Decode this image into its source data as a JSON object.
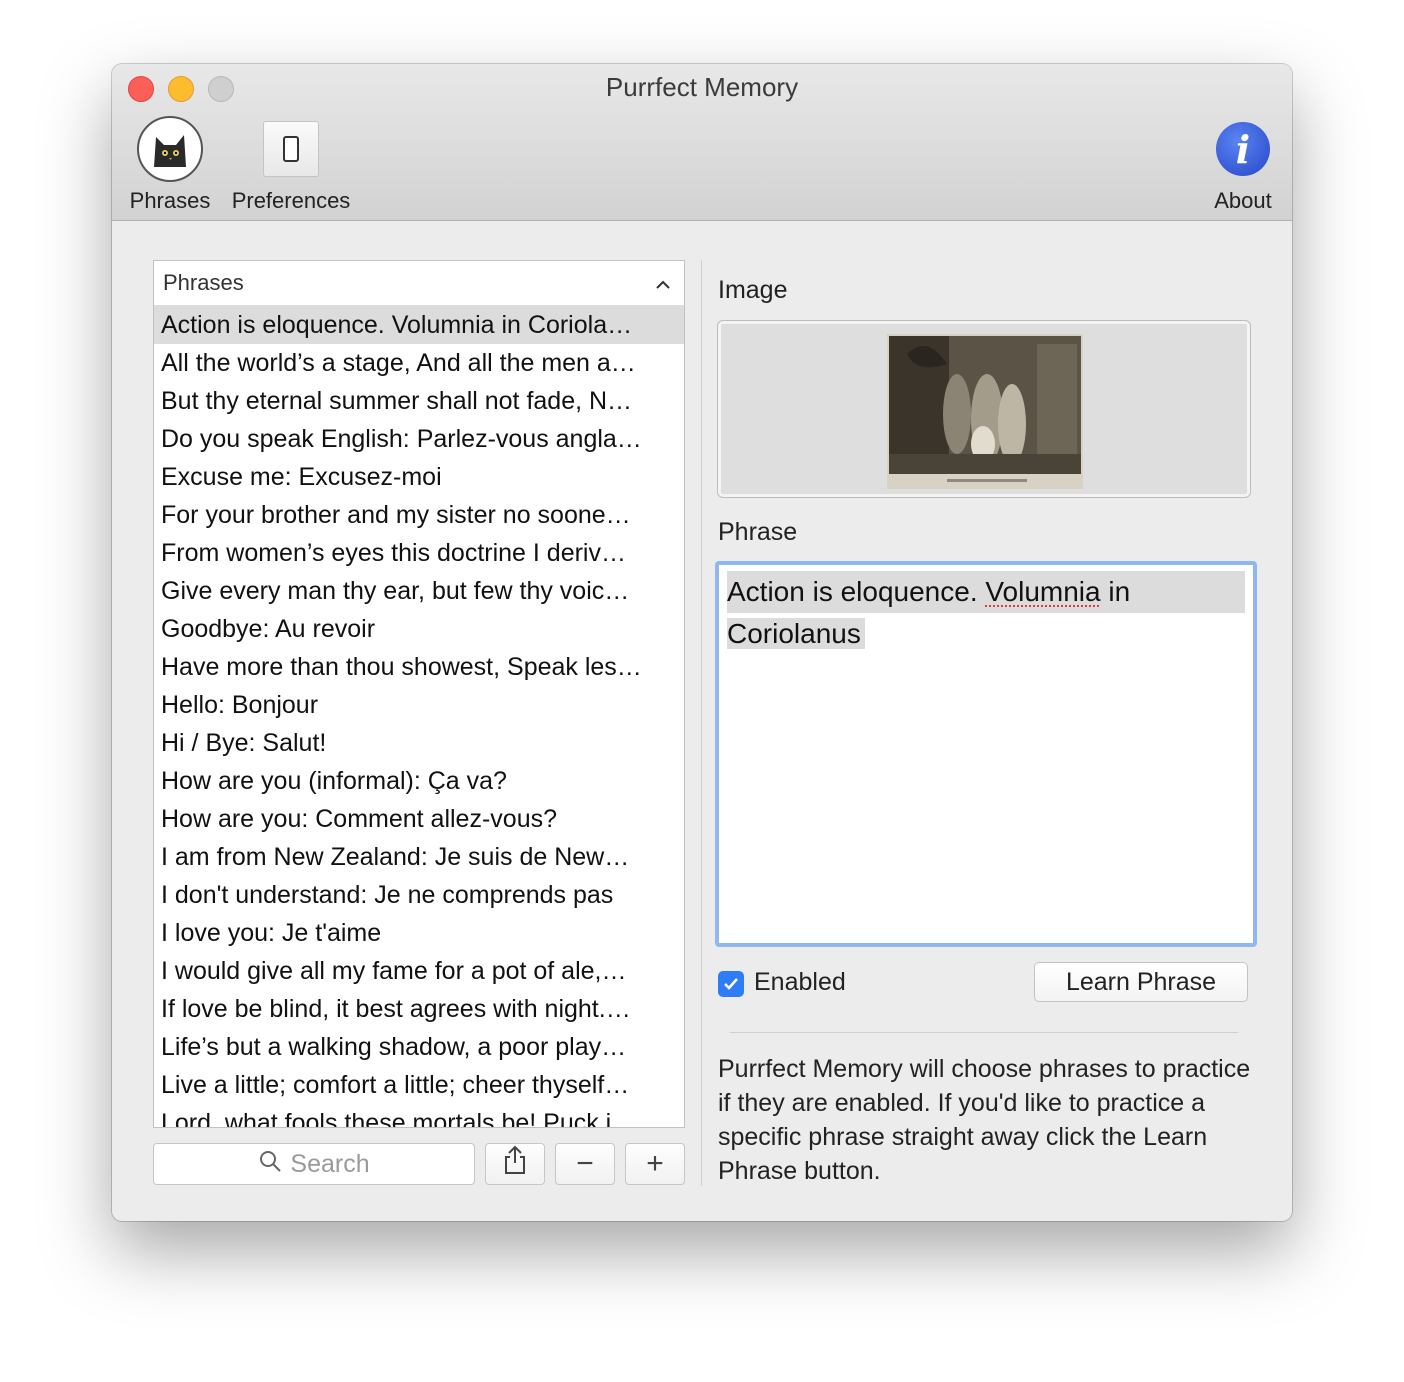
{
  "window": {
    "title": "Purrfect Memory"
  },
  "toolbar": {
    "phrases_label": "Phrases",
    "preferences_label": "Preferences",
    "about_label": "About",
    "about_glyph": "i"
  },
  "list": {
    "header": "Phrases",
    "sort_indicator": "chevron-up",
    "items": [
      "Action is eloquence. Volumnia in Coriola…",
      "All the world’s a stage, And all the men a…",
      "But thy eternal summer shall not fade, N…",
      "Do you speak English: Parlez-vous angla…",
      "Excuse me: Excusez-moi",
      "For your brother and my sister no soone…",
      "From women’s eyes this doctrine I deriv…",
      "Give every man thy ear, but few thy voic…",
      "Goodbye: Au revoir",
      "Have more than thou showest, Speak les…",
      "Hello: Bonjour",
      "Hi / Bye: Salut!",
      "How are you (informal): Ça va?",
      "How are you: Comment allez-vous?",
      "I am from New Zealand: Je suis de New…",
      "I don't understand: Je ne comprends pas",
      "I love you: Je t'aime",
      "I would give all my fame for a pot of ale,…",
      "If love be blind, it best agrees with night.…",
      "Life’s but a walking shadow, a poor play…",
      "Live a little; comfort a little; cheer thyself…",
      "Lord, what fools these mortals be! Puck i…"
    ],
    "selected_index": 0
  },
  "search": {
    "placeholder": "Search"
  },
  "buttons": {
    "share": "share-icon",
    "remove": "−",
    "add": "+"
  },
  "detail": {
    "image_label": "Image",
    "phrase_label": "Phrase",
    "phrase_line1_a": "Action is eloquence. ",
    "phrase_line1_b": "Volumnia",
    "phrase_line1_c": " in",
    "phrase_line2": "Coriolanus",
    "enabled_label": "Enabled",
    "enabled": true,
    "learn_button": "Learn Phrase",
    "help_text": "Purrfect Memory will choose phrases to practice if they are enabled. If you'd like to practice a specific phrase straight away click the Learn Phrase button."
  },
  "colors": {
    "accent": "#2e7cf6",
    "focus_ring": "#8fb8ee",
    "about_icon": "#3457d5"
  }
}
